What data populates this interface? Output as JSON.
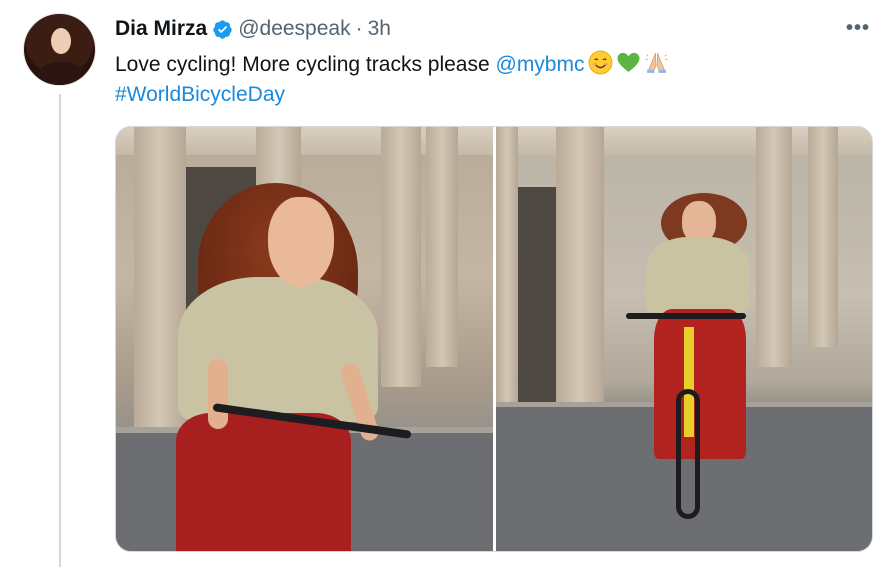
{
  "tweet": {
    "author_name": "Dia Mirza",
    "handle": "@deespeak",
    "separator": "·",
    "time": "3h",
    "more_label": "•••",
    "text_before_mention": "Love cycling! More cycling tracks please ",
    "mention": "@mybmc",
    "hashtag": "#WorldBicycleDay",
    "emojis": [
      "smiling-face-with-smiling-eyes",
      "green-heart",
      "folded-hands"
    ]
  },
  "colors": {
    "link": "#1b8ad8",
    "verified": "#1d9bf0",
    "secondary_text": "#536471",
    "thread_line": "#cfd9de"
  }
}
